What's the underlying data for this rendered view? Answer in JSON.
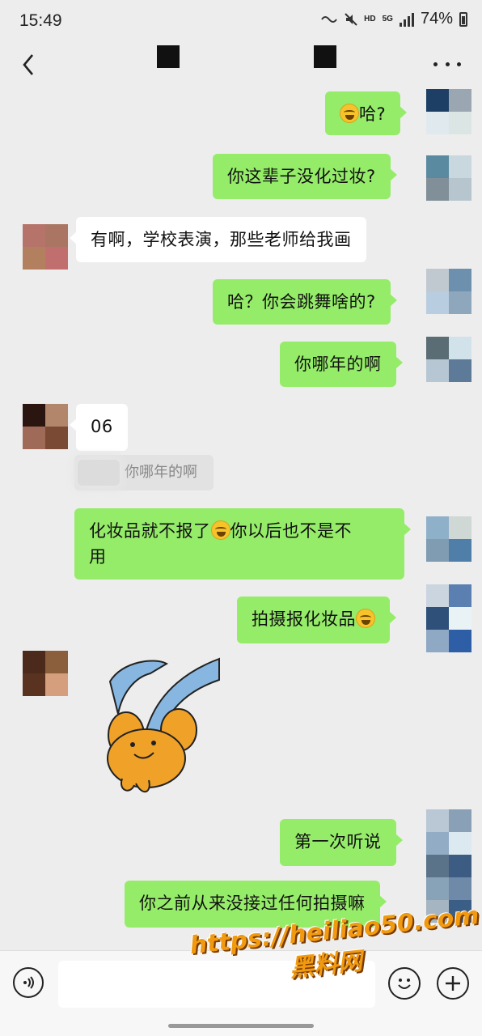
{
  "status_bar": {
    "time": "15:49",
    "hd": "HD",
    "net": "5G",
    "battery": "74%"
  },
  "header": {
    "back_icon": "chevron-left-icon",
    "more_icon": "more-dots-icon"
  },
  "messages": [
    {
      "side": "me",
      "text_after_emoji": "哈?",
      "emoji": "laughing-crying-emoji"
    },
    {
      "side": "me",
      "text": "你这辈子没化过妆?"
    },
    {
      "side": "other",
      "text": "有啊，学校表演，那些老师给我画"
    },
    {
      "side": "me",
      "text": "哈？你会跳舞啥的?"
    },
    {
      "side": "me",
      "text": "你哪年的啊"
    },
    {
      "side": "other",
      "text": "06",
      "quote": "你哪年的啊"
    },
    {
      "side": "me",
      "text_line1_a": "化妆品就不报了",
      "text_line1_b": "你以后也不是不",
      "text_line2": "用",
      "emoji": "laughing-crying-emoji"
    },
    {
      "side": "me",
      "text": "拍摄报化妆品",
      "emoji": "laughing-crying-emoji"
    },
    {
      "side": "other",
      "sticker": "orange-bear-with-blue-ribbons-sticker"
    },
    {
      "side": "me",
      "text": "第一次听说"
    },
    {
      "side": "me",
      "text": "你之前从来没接过任何拍摄嘛"
    }
  ],
  "input_bar": {
    "voice_icon": "voice-icon",
    "emoji_icon": "smiley-icon",
    "plus_icon": "plus-icon",
    "placeholder": ""
  },
  "watermark": {
    "line1": "https://heiliao50.com",
    "line2": "黑料网"
  },
  "colors": {
    "background": "#ededed",
    "my_bubble": "#95ec69",
    "other_bubble": "#ffffff",
    "watermark": "#f29a0f"
  }
}
